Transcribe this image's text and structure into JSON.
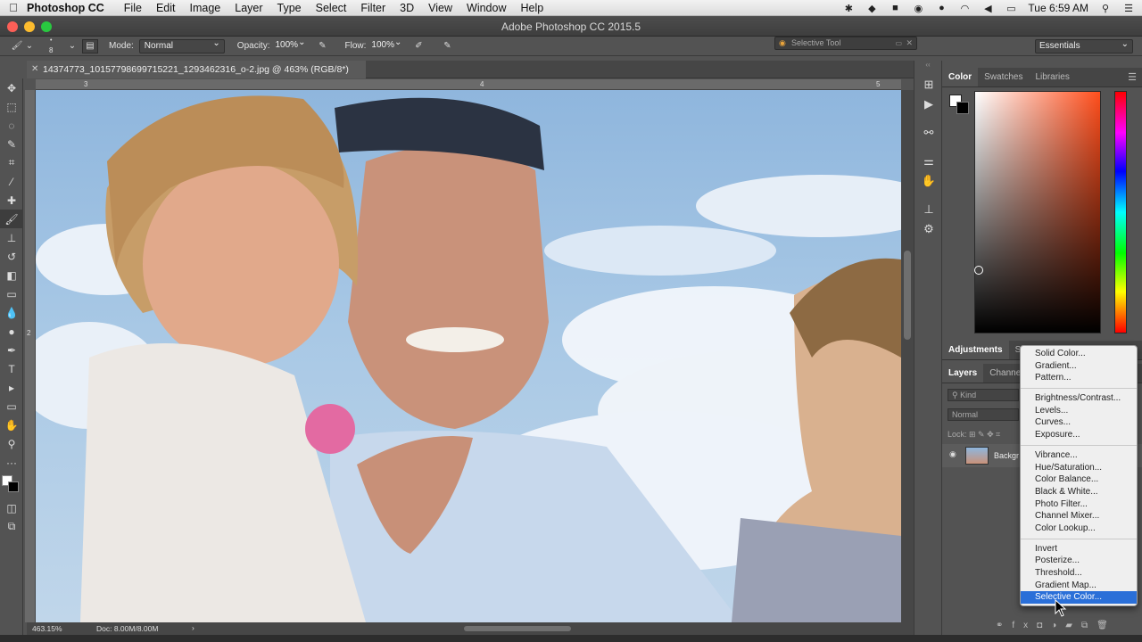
{
  "menubar": {
    "app": "Photoshop CC",
    "items": [
      "File",
      "Edit",
      "Image",
      "Layer",
      "Type",
      "Select",
      "Filter",
      "3D",
      "View",
      "Window",
      "Help"
    ],
    "clock": "Tue 6:59 AM"
  },
  "window": {
    "title": "Adobe Photoshop CC 2015.5"
  },
  "options": {
    "brush_size": "8",
    "mode_label": "Mode:",
    "mode_value": "Normal",
    "opacity_label": "Opacity:",
    "opacity_value": "100%",
    "flow_label": "Flow:",
    "flow_value": "100%",
    "search_text": "Selective Tool",
    "workspace": "Essentials"
  },
  "document": {
    "tab_title": "14374773_10157798699715221_1293462316_o-2.jpg @ 463% (RGB/8*)",
    "ruler_top_marks": [
      "3",
      "4",
      "5"
    ],
    "ruler_left_marks": [
      "2"
    ],
    "zoom": "463.15%",
    "doc_size": "Doc: 8.00M/8.00M"
  },
  "right_panel": {
    "color_tabs": [
      "Color",
      "Swatches",
      "Libraries"
    ],
    "adjust_tabs": [
      "Adjustments",
      "Sty"
    ],
    "layers_tabs": [
      "Layers",
      "Channels"
    ],
    "kind_label": "Kind",
    "blend_mode": "Normal",
    "lock_label": "Lock:",
    "layer_name": "Backgr"
  },
  "adjustment_menu": {
    "groups": [
      [
        "Solid Color...",
        "Gradient...",
        "Pattern..."
      ],
      [
        "Brightness/Contrast...",
        "Levels...",
        "Curves...",
        "Exposure..."
      ],
      [
        "Vibrance...",
        "Hue/Saturation...",
        "Color Balance...",
        "Black & White...",
        "Photo Filter...",
        "Channel Mixer...",
        "Color Lookup..."
      ],
      [
        "Invert",
        "Posterize...",
        "Threshold...",
        "Gradient Map...",
        "Selective Color..."
      ]
    ],
    "selected": "Selective Color..."
  },
  "colors": {
    "panel_bg": "#535353",
    "menu_highlight": "#2a6fd8",
    "foreground": "#ffffff",
    "background": "#000000"
  }
}
